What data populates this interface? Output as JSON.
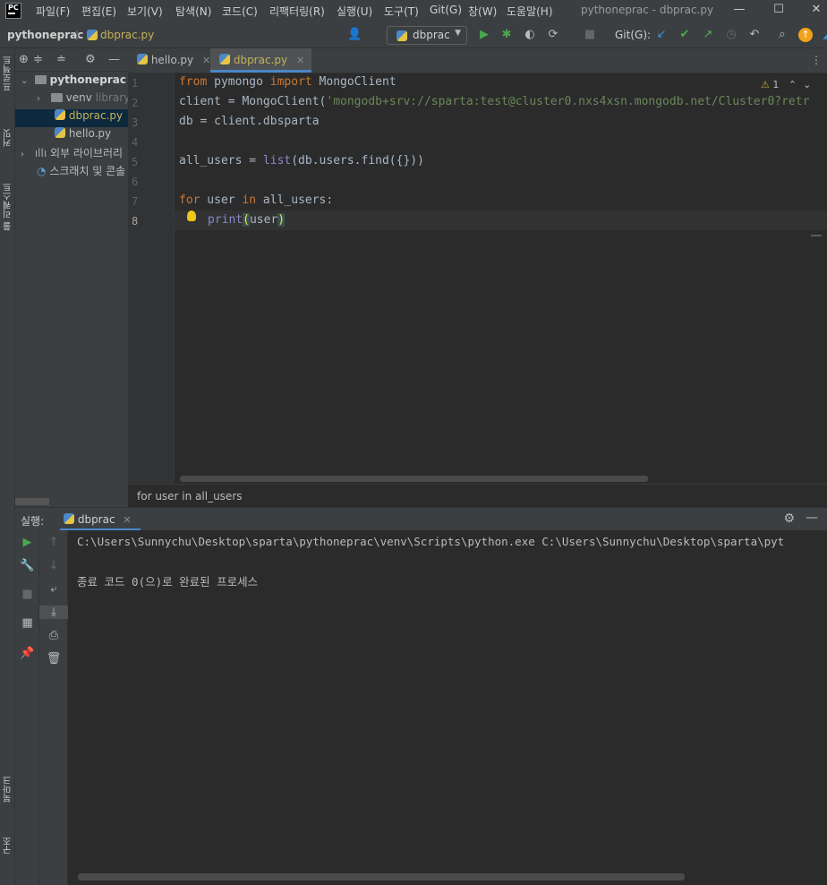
{
  "menubar": {
    "logo": "PC",
    "items": [
      "파일(F)",
      "편집(E)",
      "보기(V)",
      "탐색(N)",
      "코드(C)",
      "리팩터링(R)",
      "실행(U)",
      "도구(T)",
      "Git(G)",
      "창(W)",
      "도움말(H)"
    ],
    "window_title": "pythoneprac - dbprac.py"
  },
  "navbar": {
    "project": "pythoneprac",
    "file": "dbprac.py",
    "run_config": "dbprac",
    "git_label": "Git(G):"
  },
  "left_strip": {
    "project_label": "프로젝트",
    "commit_label": "커밋",
    "pull_requests_label": "풀 리퀘스트",
    "bookmarks_label": "북마크",
    "structure_label": "구조"
  },
  "project_tree": {
    "root": "pythoneprac",
    "root_suffix": "C",
    "venv": "venv",
    "venv_hint": "library",
    "file1": "dbprac.py",
    "file2": "hello.py",
    "external_libs": "외부 라이브러리",
    "scratches": "스크래치 및 콘솔"
  },
  "tabs": [
    {
      "label": "hello.py"
    },
    {
      "label": "dbprac.py"
    }
  ],
  "editor": {
    "line_numbers": [
      "1",
      "2",
      "3",
      "4",
      "5",
      "6",
      "7",
      "8"
    ],
    "warnings": "1",
    "lines": {
      "l1_from": "from",
      "l1_mod": " pymongo ",
      "l1_import": "import",
      "l1_cls": " MongoClient",
      "l2_a": "client = MongoClient(",
      "l2_str": "'mongodb+srv://sparta:test@cluster0.nxs4xsn.mongodb.net/Cluster0?retr",
      "l3": "db = client.dbsparta",
      "l5_a": "all_users = ",
      "l5_fn": "list",
      "l5_b": "(db.users.find({}))",
      "l7_for": "for",
      "l7_a": " user ",
      "l7_in": "in",
      "l7_b": " all_users:",
      "l8_fn": "print",
      "l8_open": "(",
      "l8_arg": "user",
      "l8_close": ")"
    }
  },
  "code_breadcrumb": "for user in all_users",
  "run_panel": {
    "label": "실행:",
    "tab": "dbprac",
    "console": [
      "C:\\Users\\Sunnychu\\Desktop\\sparta\\pythoneprac\\venv\\Scripts\\python.exe C:\\Users\\Sunnychu\\Desktop\\sparta\\pyt",
      "",
      "종료 코드 0(으)로 완료된 프로세스"
    ]
  },
  "colors": {
    "keyword": "#cc7832",
    "string": "#6a8759",
    "builtin": "#8888c6",
    "accent": "#4a88c7"
  }
}
